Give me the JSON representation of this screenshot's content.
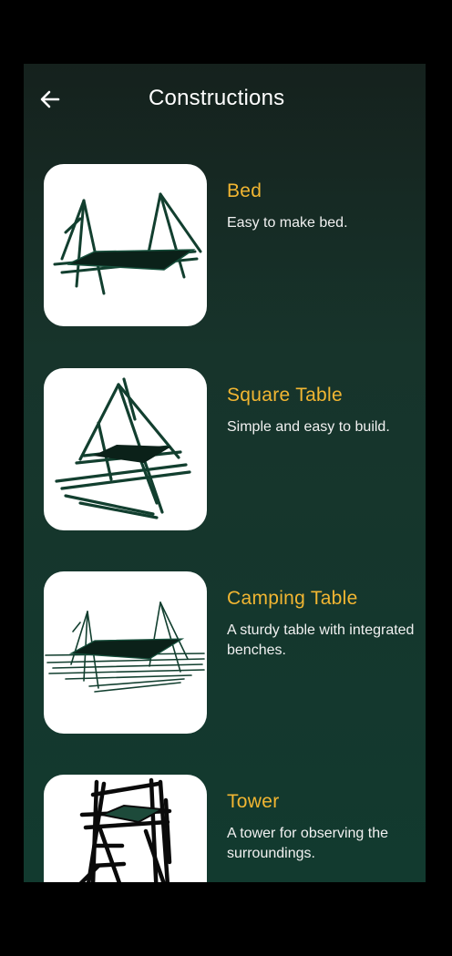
{
  "header": {
    "title": "Constructions",
    "back_icon": "arrow-left-icon"
  },
  "colors": {
    "title_accent": "#f2b632",
    "background_top": "#15211d",
    "background_bottom": "#123a2f",
    "card_bg": "#ffffff",
    "sketch_pole": "#123f2f"
  },
  "constructions": [
    {
      "title": "Bed",
      "description": "Easy to make bed.",
      "icon": "bed-construction-icon"
    },
    {
      "title": "Square Table",
      "description": "Simple and easy to build.",
      "icon": "square-table-construction-icon"
    },
    {
      "title": "Camping Table",
      "description": "A sturdy table with integrated benches.",
      "icon": "camping-table-construction-icon"
    },
    {
      "title": "Tower",
      "description": "A tower for observing the surroundings.",
      "icon": "tower-construction-icon"
    }
  ]
}
